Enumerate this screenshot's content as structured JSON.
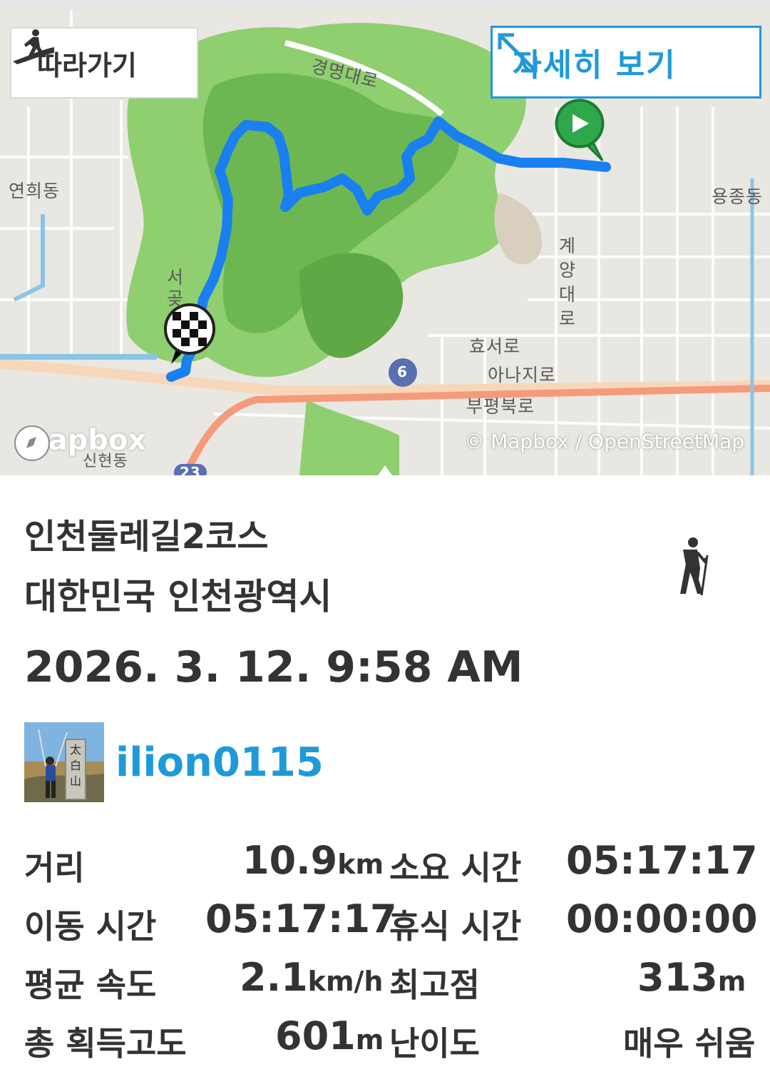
{
  "map": {
    "follow_button": "따라가기",
    "detail_button": "자세히 보기",
    "labels": {
      "road_gyeongmyeong": "경명대로",
      "dong_yeonhui": "연희동",
      "dong_yongjong": "용종동",
      "road_gyeyang": "계양대로",
      "place_seogot": "서곶",
      "road_hyoseo": "효서로",
      "road_anaji": "아나지로",
      "road_bupyeongbuk": "부평북로",
      "dong_sinhyeon": "신현동",
      "route_number": "6",
      "route_number_2": "23"
    },
    "provider_logo": "mapbox",
    "attribution": "© Mapbox / OpenStreetMap",
    "route_color": "#1a7ff0",
    "start_marker_color": "#2ea84a"
  },
  "activity": {
    "title": "인천둘레길2코스",
    "location": "대한민국 인천광역시",
    "datetime": "2026. 3. 12. 9:58 AM",
    "type_icon": "hiker-icon"
  },
  "user": {
    "name": "ilion0115",
    "avatar_stone_text": "太白山"
  },
  "stats": {
    "distance_label": "거리",
    "distance_value": "10.9",
    "distance_unit": "km",
    "duration_label": "소요 시간",
    "duration_value": "05:17:17",
    "moving_label": "이동 시간",
    "moving_value": "05:17:17",
    "rest_label": "휴식 시간",
    "rest_value": "00:00:00",
    "speed_label": "평균 속도",
    "speed_value": "2.1",
    "speed_unit": "km/h",
    "max_alt_label": "최고점",
    "max_alt_value": "313",
    "max_alt_unit": "m",
    "gain_label": "총 획득고도",
    "gain_value": "601",
    "gain_unit": "m",
    "difficulty_label": "난이도",
    "difficulty_value": "매우 쉬움"
  }
}
